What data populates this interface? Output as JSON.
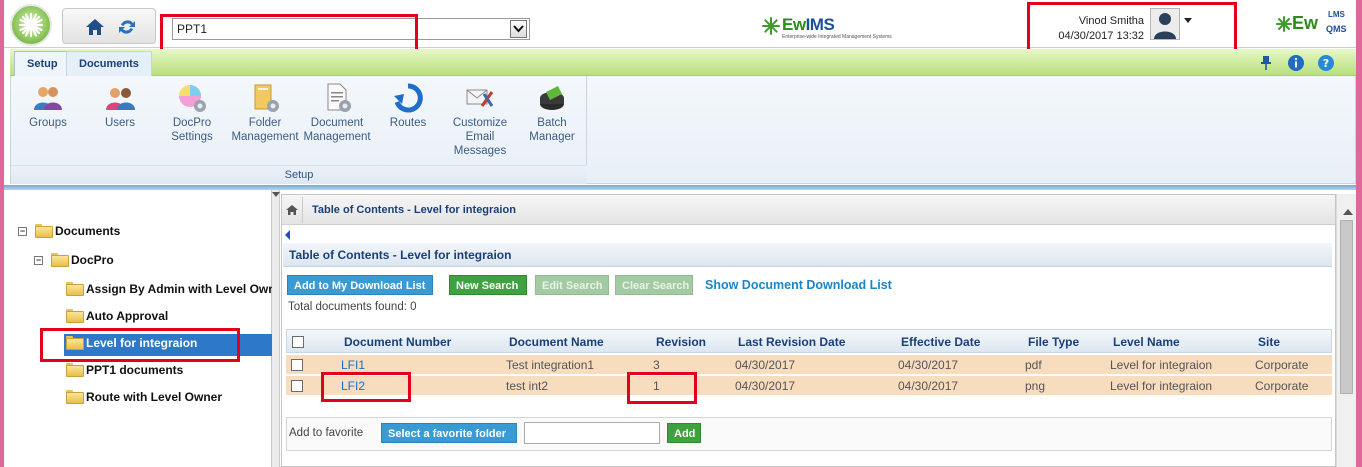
{
  "header": {
    "document_select": {
      "value": "PPT1"
    },
    "center_logo": {
      "name": "EwIMS",
      "prefix": "Ew",
      "suffix": "IMS",
      "tagline": "Enterprise-wide Integrated Management Systems"
    },
    "user": {
      "name": "Vinod Smitha",
      "datetime": "04/30/2017 13:32"
    },
    "brand_right": {
      "ew": "Ew",
      "lms": "LMS",
      "qms": "QMS"
    }
  },
  "ribbon": {
    "tabs": [
      {
        "label": "Setup",
        "active": true
      },
      {
        "label": "Documents",
        "active": false
      }
    ],
    "group_label": "Setup",
    "buttons": [
      {
        "line1": "Groups",
        "line2": "",
        "line3": ""
      },
      {
        "line1": "Users",
        "line2": "",
        "line3": ""
      },
      {
        "line1": "DocPro",
        "line2": "Settings",
        "line3": ""
      },
      {
        "line1": "Folder",
        "line2": "Management",
        "line3": ""
      },
      {
        "line1": "Document",
        "line2": "Management",
        "line3": ""
      },
      {
        "line1": "Routes",
        "line2": "",
        "line3": ""
      },
      {
        "line1": "Customize",
        "line2": "Email",
        "line3": "Messages"
      },
      {
        "line1": "Batch",
        "line2": "Manager",
        "line3": ""
      }
    ]
  },
  "tree": {
    "root": "Documents",
    "child": "DocPro",
    "folders": [
      "Assign By Admin with Level Owner",
      "Auto Approval",
      "Level for integraion",
      "PPT1 documents",
      "Route with Level Owner"
    ],
    "selected": "Level for integraion"
  },
  "main": {
    "breadcrumb": "Table of Contents - Level for integraion",
    "section_title": "Table of Contents - Level for integraion",
    "actions": {
      "add_download": "Add to My Download List",
      "new_search": "New Search",
      "edit_search": "Edit Search",
      "clear_search": "Clear Search",
      "show_download": "Show Document Download List"
    },
    "total_found": "Total documents found: 0",
    "columns": [
      "Document Number",
      "Document Name",
      "Revision",
      "Last Revision Date",
      "Effective Date",
      "File Type",
      "Level Name",
      "Site"
    ],
    "rows": [
      {
        "number": "LFI1",
        "name": "Test integration1",
        "revision": "3",
        "last_rev": "04/30/2017",
        "effective": "04/30/2017",
        "type": "pdf",
        "level": "Level for integraion",
        "site": "Corporate"
      },
      {
        "number": "LFI2",
        "name": "test int2",
        "revision": "1",
        "last_rev": "04/30/2017",
        "effective": "04/30/2017",
        "type": "png",
        "level": "Level for integraion",
        "site": "Corporate"
      }
    ],
    "favorite": {
      "label": "Add to favorite",
      "select_button": "Select a favorite folder",
      "input_value": "",
      "add_button": "Add"
    }
  },
  "colors": {
    "highlight_red": "#e3001b",
    "ribbon_green": "#b8e07a",
    "row_highlight": "#f7dcbd",
    "link_blue": "#1a6fc8"
  }
}
